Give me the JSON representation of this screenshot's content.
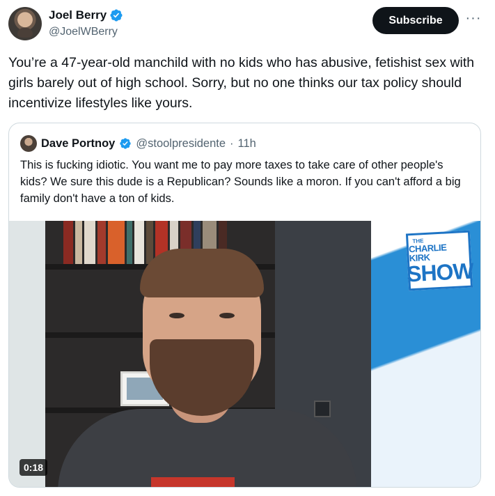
{
  "post": {
    "author_name": "Joel Berry",
    "author_handle": "@JoelWBerry",
    "subscribe_label": "Subscribe",
    "more_label": "···",
    "text": "You’re a 47-year-old manchild with no kids who has abusive, fetishist sex with girls barely out of high school. Sorry, but no one thinks our tax policy should incentivize lifestyles like yours."
  },
  "quote": {
    "author_name": "Dave Portnoy",
    "author_handle": "@stoolpresidente",
    "separator": "·",
    "time": "11h",
    "text": "This is fucking idiotic.  You want me to pay more taxes to take care of other people's kids?  We sure this dude is a Republican?  Sounds like a moron.  If you can't afford a big family don't have a ton of kids.",
    "video": {
      "duration": "0:18",
      "brand_the": "THE",
      "brand_name": "CHARLIE KIRK",
      "brand_show": "SHOW"
    }
  },
  "colors": {
    "verified": "#1d9bf0",
    "text_primary": "#0f1419",
    "text_secondary": "#536471",
    "border": "#cfd9de",
    "brand_blue": "#1d74c5"
  },
  "icons": {
    "verified": "verified-badge-icon",
    "more": "more-horizontal-icon"
  }
}
